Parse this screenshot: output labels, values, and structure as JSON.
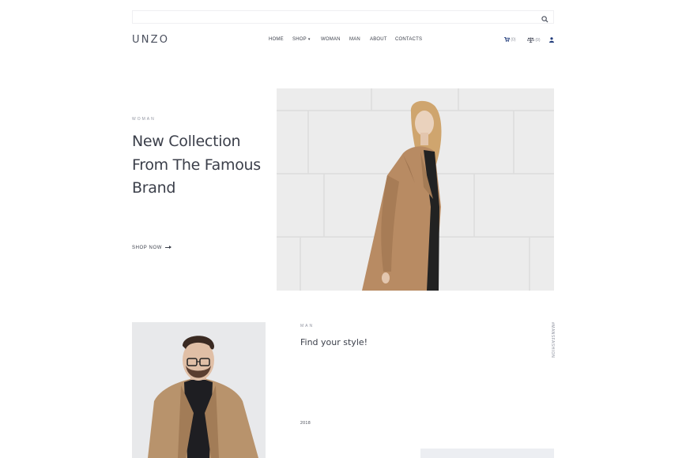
{
  "search": {
    "placeholder": ""
  },
  "header": {
    "logo": "UNZO",
    "nav": [
      {
        "label": "HOME"
      },
      {
        "label": "SHOP"
      },
      {
        "label": "WOMAN"
      },
      {
        "label": "MAN"
      },
      {
        "label": "ABOUT"
      },
      {
        "label": "CONTACTS"
      }
    ],
    "cart_count": "(0)",
    "compare_count": "(0)",
    "icons": [
      "search-icon",
      "chevron-down-icon",
      "cart-icon",
      "scales-icon",
      "user-icon",
      "arrow-right-icon"
    ]
  },
  "hero": {
    "label": "WOMAN",
    "title_lines": [
      "New Collection",
      "From The Famous",
      "Brand"
    ],
    "cta": "SHOP NOW"
  },
  "man_section": {
    "label": "MAN",
    "title": "Find your style!",
    "year": "2018",
    "vertical_tag": "#MANSFASHION"
  },
  "colors": {
    "text": "#3b3f4a",
    "muted": "#9094a0",
    "coat": "#b88b63"
  }
}
